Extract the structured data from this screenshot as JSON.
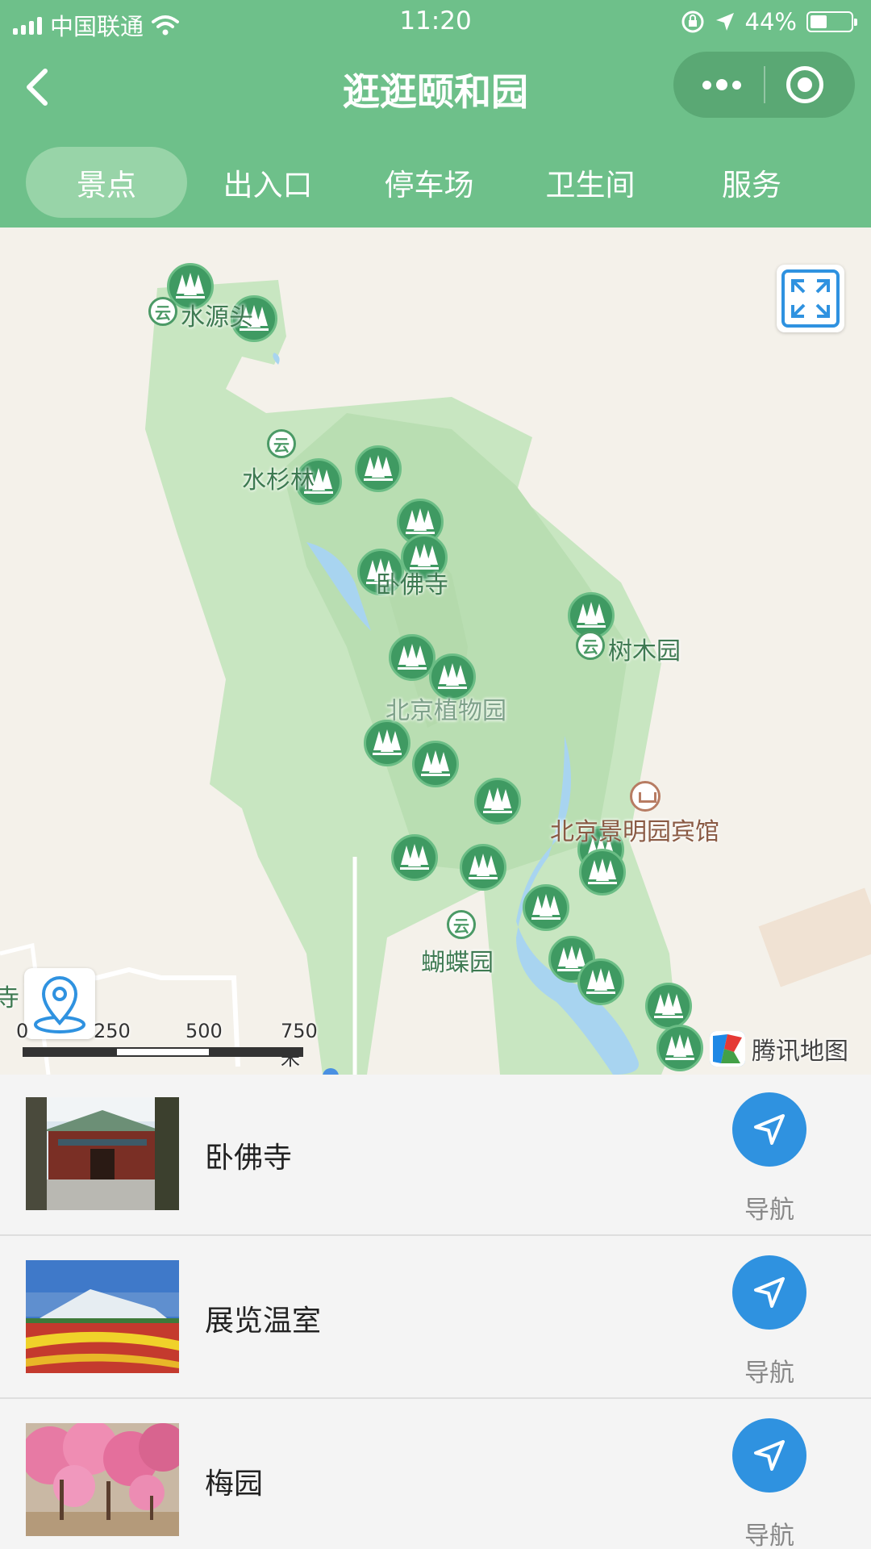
{
  "status_bar": {
    "carrier": "中国联通",
    "time": "11:20",
    "battery": "44%",
    "battery_level": 0.44
  },
  "nav": {
    "title": "逛逛颐和园"
  },
  "tabs": [
    {
      "label": "景点",
      "active": true
    },
    {
      "label": "出入口",
      "active": false
    },
    {
      "label": "停车场",
      "active": false
    },
    {
      "label": "卫生间",
      "active": false
    },
    {
      "label": "服务",
      "active": false
    }
  ],
  "map": {
    "places": {
      "shuiyuantou": "水源头",
      "shuishanlin": "水杉林",
      "wofosi_label": "卧佛寺",
      "shumuyuan": "树木园",
      "zhiwuyuan": "北京植物园",
      "hotel": "北京景明园宾馆",
      "hudieyuan": "蝴蝶园",
      "edge_temple": "寺"
    },
    "gate_glyph": "云",
    "scale_labels": [
      "0",
      "250",
      "500",
      "750 米"
    ],
    "brand": "腾讯地图",
    "colors": {
      "park": "#c8e6c1",
      "water": "#a8d4f0",
      "poi": "#3f9a62",
      "background": "#f4f1ea"
    }
  },
  "attractions": [
    {
      "name": "卧佛寺",
      "nav_label": "导航",
      "thumb": "temple-photo"
    },
    {
      "name": "展览温室",
      "nav_label": "导航",
      "thumb": "greenhouse-photo"
    },
    {
      "name": "梅园",
      "nav_label": "导航",
      "thumb": "plum-garden-photo"
    }
  ],
  "colors": {
    "header": "#6ec08a",
    "nav_button": "#2f92e0"
  }
}
